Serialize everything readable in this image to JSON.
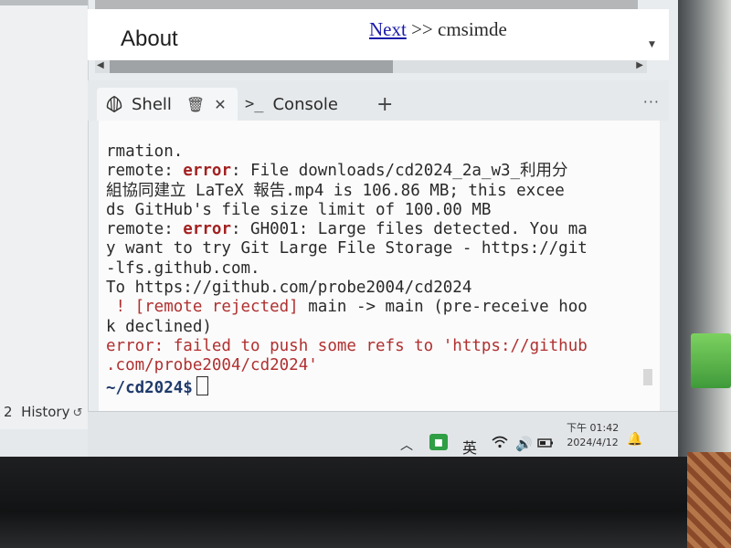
{
  "page": {
    "about_label": "About",
    "next_link": "Next",
    "next_suffix": " >> cmsimde"
  },
  "tabs": [
    {
      "label": "Shell",
      "icon": "shell-icon",
      "active": true
    },
    {
      "label": "Console",
      "icon": "terminal-prompt-icon",
      "active": false
    }
  ],
  "tab_add": "+",
  "tab_more": "···",
  "terminal": {
    "lines": [
      [
        {
          "t": "rmation."
        }
      ],
      [
        {
          "t": "remote: "
        },
        {
          "t": "error",
          "c": "err"
        },
        {
          "t": ": File downloads/cd2024_2a_w3_利用分"
        }
      ],
      [
        {
          "t": "組協同建立 LaTeX 報告.mp4 is 106.86 MB; this excee"
        }
      ],
      [
        {
          "t": "ds GitHub's file size limit of 100.00 MB"
        }
      ],
      [
        {
          "t": "remote: "
        },
        {
          "t": "error",
          "c": "err"
        },
        {
          "t": ": GH001: Large files detected. You ma"
        }
      ],
      [
        {
          "t": "y want to try Git Large File Storage - https://git"
        }
      ],
      [
        {
          "t": "-lfs.github.com."
        }
      ],
      [
        {
          "t": "To https://github.com/probe2004/cd2024"
        }
      ],
      [
        {
          "t": " ! [remote rejected] ",
          "c": "red"
        },
        {
          "t": "main -> main (pre-receive hoo"
        }
      ],
      [
        {
          "t": "k declined)"
        }
      ],
      [
        {
          "t": "error: failed to push some refs to 'https://github",
          "c": "red"
        }
      ],
      [
        {
          "t": ".com/probe2004/cd2024'",
          "c": "red"
        }
      ]
    ],
    "prompt": "~/cd2024$"
  },
  "sidebar": {
    "number": "2",
    "history_label": "History"
  },
  "taskbar": {
    "ime": "英",
    "time": "下午 01:42",
    "date": "2024/4/12"
  },
  "colors": {
    "error_red": "#a32121",
    "prompt_blue": "#1f3a6b",
    "link_blue": "#1a1aa8"
  }
}
